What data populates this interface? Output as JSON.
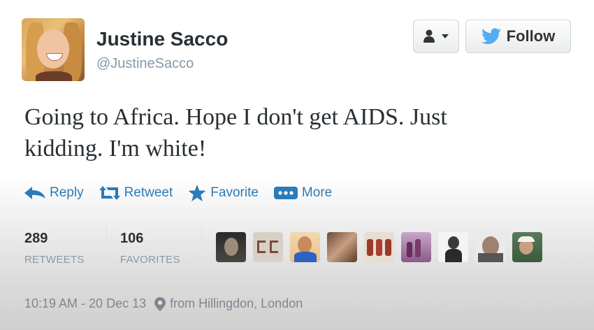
{
  "profile": {
    "name": "Justine Sacco",
    "handle": "@JustineSacco"
  },
  "header_buttons": {
    "follow_label": "Follow"
  },
  "tweet": {
    "text_line1": "Going to Africa. Hope I don't get AIDS. Just",
    "text_line2": "kidding. I'm white!"
  },
  "actions": [
    {
      "label": "Reply",
      "icon": "reply-icon"
    },
    {
      "label": "Retweet",
      "icon": "retweet-icon"
    },
    {
      "label": "Favorite",
      "icon": "star-icon"
    },
    {
      "label": "More",
      "icon": "more-dots-icon"
    }
  ],
  "stats": {
    "retweets_count": "289",
    "retweets_label": "RETWEETS",
    "favorites_count": "106",
    "favorites_label": "FAVORITES"
  },
  "footer": {
    "timestamp": "10:19 AM - 20 Dec 13",
    "location": "from Hillingdon, London"
  },
  "colors": {
    "link_blue": "#2b7bb9",
    "twitter_bird": "#55acee",
    "muted_gray": "#8899a6"
  }
}
